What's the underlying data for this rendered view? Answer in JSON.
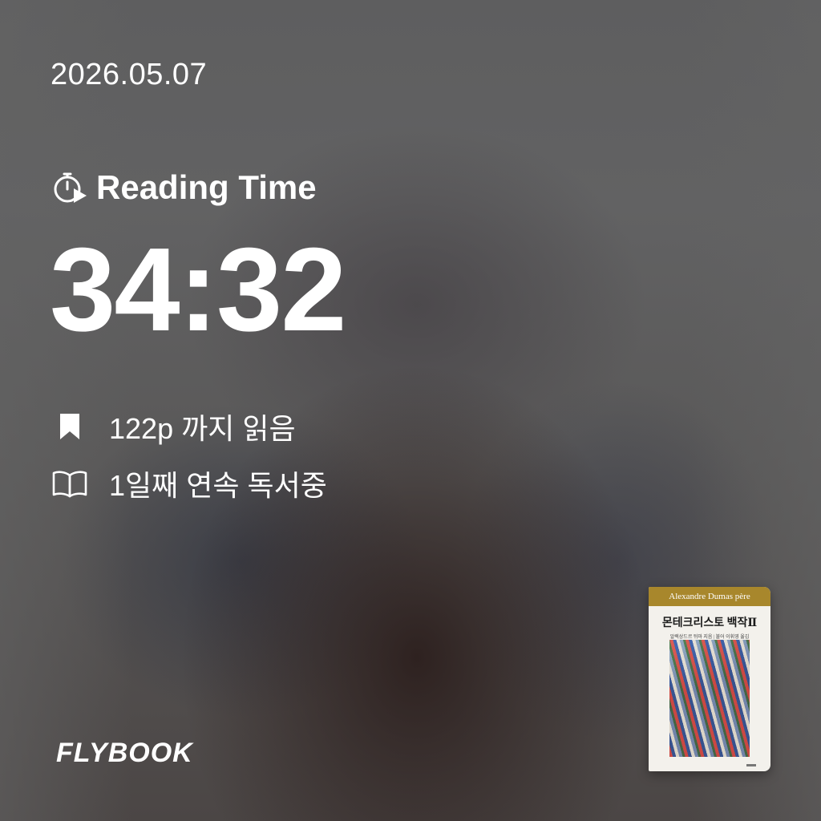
{
  "date": "2026.05.07",
  "reading": {
    "label": "Reading Time",
    "elapsed": "34:32"
  },
  "stats": {
    "page_progress": "122p 까지 읽음",
    "streak": "1일째 연속 독서중"
  },
  "brand": "FLYBOOK",
  "book": {
    "author": "Alexandre Dumas père",
    "title": "몬테크리스토 백작Ⅱ",
    "subtitle": "알렉상드르 뒤마 지음 | 불어 이휘영 옮김"
  },
  "icons": {
    "timer": "stopwatch-play-icon",
    "page": "bookmark-icon",
    "streak": "open-book-icon"
  },
  "colors": {
    "text": "#ffffff",
    "background": "#5f5f60",
    "cover_band": "#a8872c"
  }
}
